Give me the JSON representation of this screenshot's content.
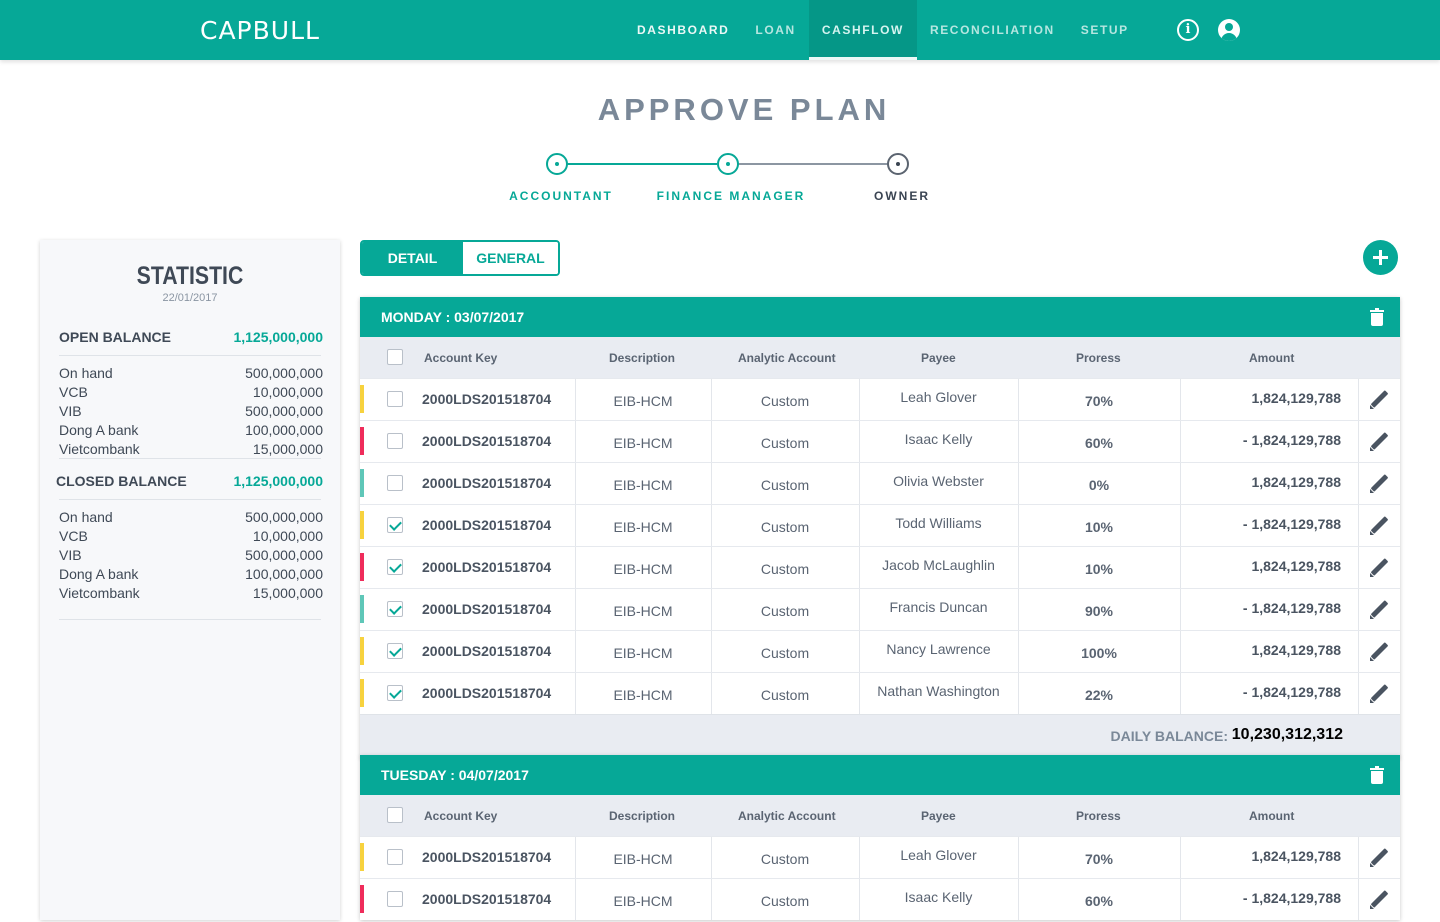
{
  "brand": "CAPBULL",
  "nav": [
    "DASHBOARD",
    "LOAN",
    "CASHFLOW",
    "RECONCILIATION",
    "SETUP"
  ],
  "nav_active": "CASHFLOW",
  "icons": {
    "info": "info-icon",
    "user": "user-icon",
    "add": "plus-icon",
    "trash": "trash-icon",
    "edit": "pencil-icon"
  },
  "colors": {
    "primary": "#06a897",
    "yellow": "#f7d23e",
    "red": "#ef2c5b",
    "teal": "#5fc7b8"
  },
  "page_title": "APPROVE PLAN",
  "steps": [
    "ACCOUNTANT",
    "FINANCE MANAGER",
    "OWNER"
  ],
  "statistic": {
    "title": "STATISTIC",
    "date": "22/01/2017",
    "open_label": "OPEN BALANCE",
    "open_value": "1,125,000,000",
    "open_items": [
      {
        "name": "On hand",
        "value": "500,000,000"
      },
      {
        "name": "VCB",
        "value": "10,000,000"
      },
      {
        "name": "VIB",
        "value": "500,000,000"
      },
      {
        "name": "Dong A bank",
        "value": "100,000,000"
      },
      {
        "name": "Vietcombank",
        "value": "15,000,000"
      }
    ],
    "closed_label": "CLOSED BALANCE",
    "closed_value": "1,125,000,000",
    "closed_items": [
      {
        "name": "On hand",
        "value": "500,000,000"
      },
      {
        "name": "VCB",
        "value": "10,000,000"
      },
      {
        "name": "VIB",
        "value": "500,000,000"
      },
      {
        "name": "Dong A bank",
        "value": "100,000,000"
      },
      {
        "name": "Vietcombank",
        "value": "15,000,000"
      }
    ]
  },
  "view_toggle": {
    "detail": "DETAIL",
    "general": "GENERAL"
  },
  "columns": [
    "Account Key",
    "Description",
    "Analytic Account",
    "Payee",
    "Proress",
    "Amount"
  ],
  "days": [
    {
      "title": "MONDAY : 03/07/2017",
      "balance_label": "DAILY BALANCE:",
      "balance_value": "10,230,312,312",
      "rows": [
        {
          "key": "2000LDS201518704",
          "desc": "EIB-HCM",
          "analytic": "Custom",
          "payee": "Leah Glover",
          "progress": "70%",
          "amount": "1,824,129,788",
          "checked": false,
          "color": "yellow"
        },
        {
          "key": "2000LDS201518704",
          "desc": "EIB-HCM",
          "analytic": "Custom",
          "payee": "Isaac Kelly",
          "progress": "60%",
          "amount": "- 1,824,129,788",
          "checked": false,
          "color": "red"
        },
        {
          "key": "2000LDS201518704",
          "desc": "EIB-HCM",
          "analytic": "Custom",
          "payee": "Olivia Webster",
          "progress": "0%",
          "amount": "1,824,129,788",
          "checked": false,
          "color": "teal"
        },
        {
          "key": "2000LDS201518704",
          "desc": "EIB-HCM",
          "analytic": "Custom",
          "payee": "Todd Williams",
          "progress": "10%",
          "amount": "- 1,824,129,788",
          "checked": true,
          "color": "yellow"
        },
        {
          "key": "2000LDS201518704",
          "desc": "EIB-HCM",
          "analytic": "Custom",
          "payee": "Jacob McLaughlin",
          "progress": "10%",
          "amount": "1,824,129,788",
          "checked": true,
          "color": "red"
        },
        {
          "key": "2000LDS201518704",
          "desc": "EIB-HCM",
          "analytic": "Custom",
          "payee": "Francis Duncan",
          "progress": "90%",
          "amount": "- 1,824,129,788",
          "checked": true,
          "color": "teal"
        },
        {
          "key": "2000LDS201518704",
          "desc": "EIB-HCM",
          "analytic": "Custom",
          "payee": "Nancy Lawrence",
          "progress": "100%",
          "amount": "1,824,129,788",
          "checked": true,
          "color": "yellow"
        },
        {
          "key": "2000LDS201518704",
          "desc": "EIB-HCM",
          "analytic": "Custom",
          "payee": "Nathan Washington",
          "progress": "22%",
          "amount": "- 1,824,129,788",
          "checked": true,
          "color": "yellow"
        }
      ]
    },
    {
      "title": "TUESDAY : 04/07/2017",
      "rows": [
        {
          "key": "2000LDS201518704",
          "desc": "EIB-HCM",
          "analytic": "Custom",
          "payee": "Leah Glover",
          "progress": "70%",
          "amount": "1,824,129,788",
          "checked": false,
          "color": "yellow"
        },
        {
          "key": "2000LDS201518704",
          "desc": "EIB-HCM",
          "analytic": "Custom",
          "payee": "Isaac Kelly",
          "progress": "60%",
          "amount": "- 1,824,129,788",
          "checked": false,
          "color": "red"
        }
      ]
    }
  ]
}
